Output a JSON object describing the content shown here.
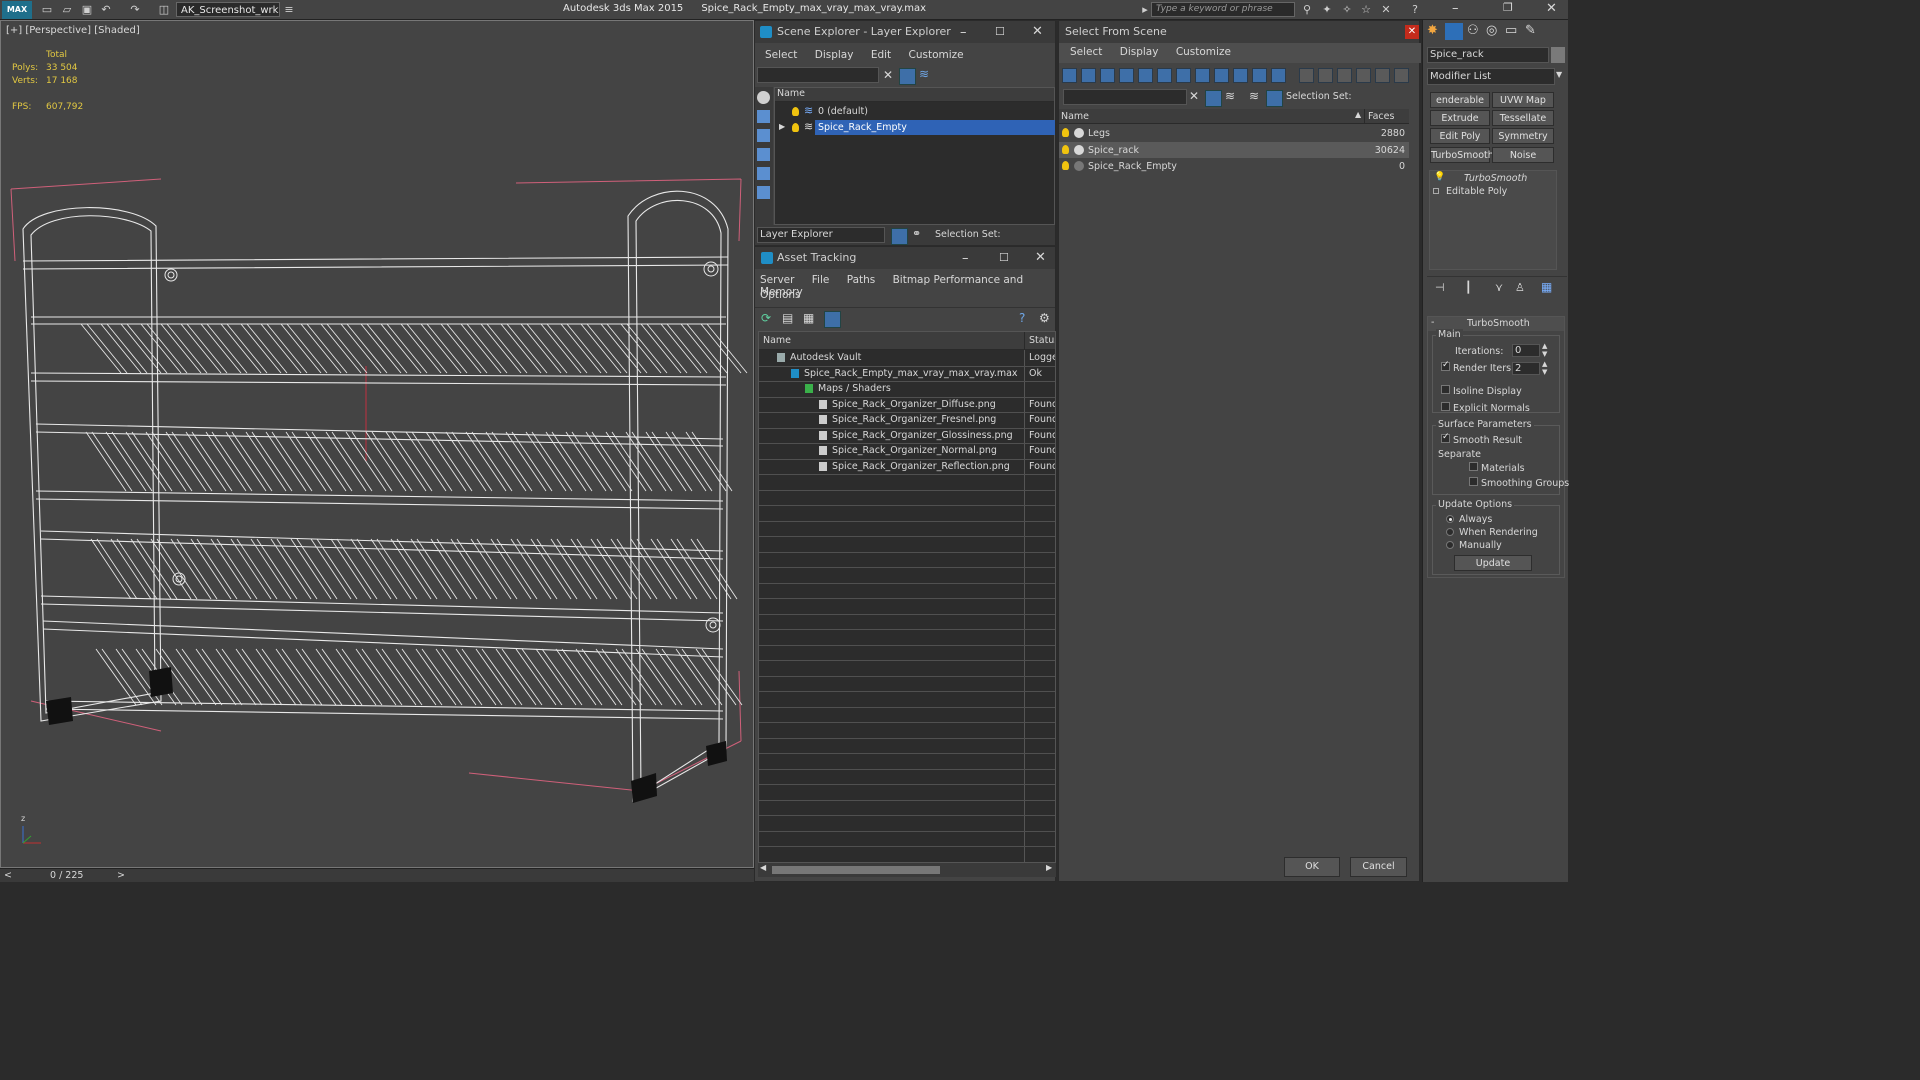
{
  "title_bar": {
    "app_title": "Autodesk 3ds Max  2015",
    "file_title": "Spice_Rack_Empty_max_vray_max_vray.max",
    "workspace": "AK_Screenshot_wrksp",
    "search_placeholder": "Type a keyword or phrase",
    "logo_text": "MAX"
  },
  "viewport": {
    "label": "[+] [Perspective] [Shaded]",
    "stats": {
      "total_label": "Total",
      "polys_label": "Polys:",
      "polys_value": "33 504",
      "verts_label": "Verts:",
      "verts_value": "17 168",
      "fps_label": "FPS:",
      "fps_value": "607,792"
    },
    "axis_label": "z"
  },
  "timeline": {
    "frame": "0 / 225",
    "prev": "<",
    "next": ">"
  },
  "scene_explorer": {
    "title": "Scene Explorer - Layer Explorer",
    "menu": [
      "Select",
      "Display",
      "Edit",
      "Customize"
    ],
    "column_name": "Name",
    "layers": [
      "0 (default)",
      "Spice_Rack_Empty"
    ],
    "footer_dropdown": "Layer Explorer",
    "selection_set_label": "Selection Set:"
  },
  "asset_tracking": {
    "title": "Asset Tracking",
    "menu": [
      "Server",
      "File",
      "Paths",
      "Bitmap Performance and Memory"
    ],
    "menu_row2": [
      "Options"
    ],
    "col_name": "Name",
    "col_status": "Status",
    "rows": [
      {
        "name": "Autodesk Vault",
        "status": "Logge"
      },
      {
        "name": "Spice_Rack_Empty_max_vray_max_vray.max",
        "status": "Ok"
      },
      {
        "name": "Maps / Shaders",
        "status": ""
      },
      {
        "name": "Spice_Rack_Organizer_Diffuse.png",
        "status": "Found"
      },
      {
        "name": "Spice_Rack_Organizer_Fresnel.png",
        "status": "Found"
      },
      {
        "name": "Spice_Rack_Organizer_Glossiness.png",
        "status": "Found"
      },
      {
        "name": "Spice_Rack_Organizer_Normal.png",
        "status": "Found"
      },
      {
        "name": "Spice_Rack_Organizer_Reflection.png",
        "status": "Found"
      }
    ]
  },
  "select_from_scene": {
    "title": "Select From Scene",
    "menu": [
      "Select",
      "Display",
      "Customize"
    ],
    "selection_set_label": "Selection Set:",
    "col_name": "Name",
    "col_faces": "Faces",
    "rows": [
      {
        "name": "Legs",
        "faces": "2880"
      },
      {
        "name": "Spice_rack",
        "faces": "30624"
      },
      {
        "name": "Spice_Rack_Empty",
        "faces": "0"
      }
    ],
    "ok_label": "OK",
    "cancel_label": "Cancel"
  },
  "modify_panel": {
    "object_name": "Spice_rack",
    "modifier_list_label": "Modifier List",
    "buttons": [
      "enderable Spli",
      "UVW Map",
      "Extrude",
      "Tessellate",
      "Edit Poly",
      "Symmetry",
      "TurboSmooth",
      "Noise"
    ],
    "stack": [
      "TurboSmooth",
      "Editable Poly"
    ],
    "rollout_title": "TurboSmooth",
    "main_label": "Main",
    "iterations_label": "Iterations:",
    "iterations_value": "0",
    "render_iters_label": "Render Iters:",
    "render_iters_value": "2",
    "isoline_label": "Isoline Display",
    "explicit_normals_label": "Explicit Normals",
    "surface_params_label": "Surface Parameters",
    "smooth_result_label": "Smooth Result",
    "separate_label": "Separate",
    "materials_label": "Materials",
    "smoothing_groups_label": "Smoothing Groups",
    "update_options_label": "Update Options",
    "always_label": "Always",
    "when_rendering_label": "When Rendering",
    "manually_label": "Manually",
    "update_button": "Update"
  },
  "colors": {
    "selection_blue": "#2f63b6",
    "stat_yellow": "#e2c842",
    "bbox_pink": "#d0607a",
    "close_red": "#c42b1c"
  }
}
